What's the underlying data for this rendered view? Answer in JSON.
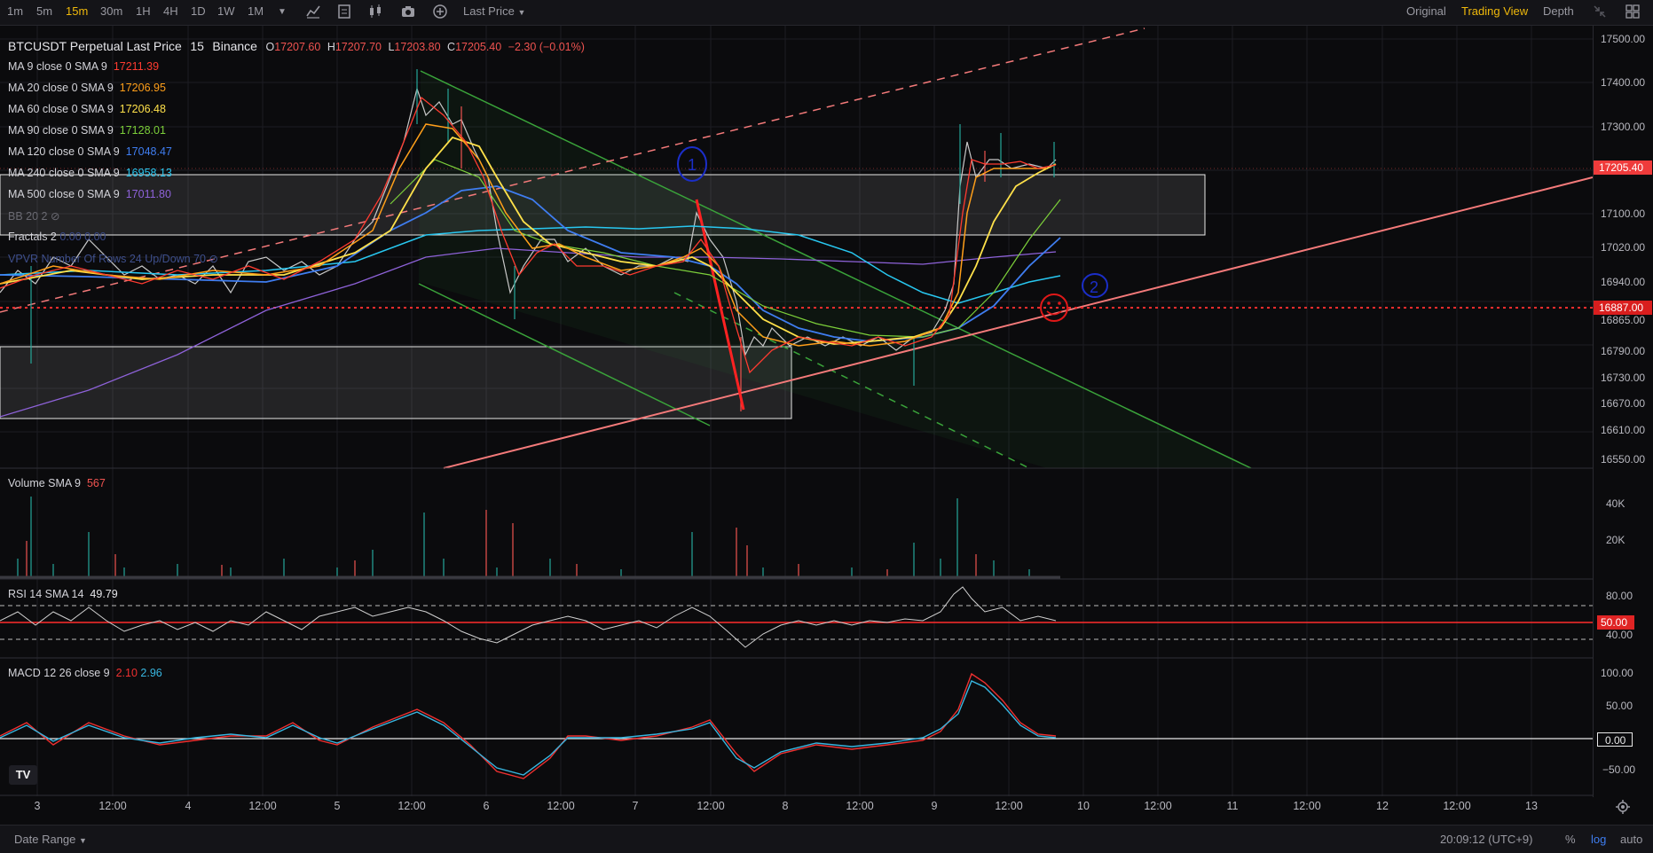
{
  "toolbar": {
    "intervals": [
      "1m",
      "5m",
      "15m",
      "30m",
      "1H",
      "4H",
      "1D",
      "1W",
      "1M"
    ],
    "active_interval": "15m",
    "price_type": "Last Price",
    "views": [
      "Original",
      "Trading View",
      "Depth"
    ],
    "active_view": "Trading View"
  },
  "header": {
    "symbol": "BTCUSDT Perpetual Last Price",
    "interval": "15",
    "exchange": "Binance",
    "open_label": "O",
    "open": "17207.60",
    "high_label": "H",
    "high": "17207.70",
    "low_label": "L",
    "low": "17203.80",
    "close_label": "C",
    "close": "17205.40",
    "change": "−2.30 (−0.01%)"
  },
  "moving_averages": [
    {
      "label": "MA 9 close 0 SMA 9",
      "value": "17211.39",
      "color": "#ff3b30"
    },
    {
      "label": "MA 20 close 0 SMA 9",
      "value": "17206.95",
      "color": "#ff9f1a"
    },
    {
      "label": "MA 60 close 0 SMA 9",
      "value": "17206.48",
      "color": "#ffe14a"
    },
    {
      "label": "MA 90 close 0 SMA 9",
      "value": "17128.01",
      "color": "#7ccf3a"
    },
    {
      "label": "MA 120 close 0 SMA 9",
      "value": "17048.47",
      "color": "#3f7df0"
    },
    {
      "label": "MA 240 close 0 SMA 9",
      "value": "16958.13",
      "color": "#28c7f0"
    },
    {
      "label": "MA 500 close 0 SMA 9",
      "value": "17011.80",
      "color": "#8e62d9"
    }
  ],
  "other_indicators": {
    "bb": "BB 20 2",
    "fractals": "Fractals 2",
    "fractals_values": "0.00  0.00",
    "vpvr": "VPVR Number Of Rows 24 Up/Down 70"
  },
  "price_axis": {
    "ticks": [
      "17500.00",
      "17400.00",
      "17300.00",
      "17205.40",
      "17100.00",
      "17020.00",
      "16940.00",
      "16887.00",
      "16865.00",
      "16790.00",
      "16730.00",
      "16670.00",
      "16610.00",
      "16550.00"
    ],
    "current_price": "17205.40",
    "marked_price": "16887.00"
  },
  "volume": {
    "label": "Volume SMA 9",
    "value": "567",
    "ticks": [
      "40K",
      "20K"
    ]
  },
  "rsi": {
    "label": "RSI 14 SMA 14",
    "value": "49.79",
    "ticks": [
      "80.00",
      "40.00"
    ],
    "mid_value": "50.00"
  },
  "macd": {
    "label": "MACD 12 26 close 9",
    "value1": "2.10",
    "value2": "2.96",
    "ticks": [
      "100.00",
      "50.00",
      "−50.00"
    ],
    "zero_value": "0.00"
  },
  "time_axis": [
    "3",
    "12:00",
    "4",
    "12:00",
    "5",
    "12:00",
    "6",
    "12:00",
    "7",
    "12:00",
    "8",
    "12:00",
    "9",
    "12:00",
    "10",
    "12:00",
    "11",
    "12:00",
    "12",
    "12:00",
    "13"
  ],
  "annotations": {
    "circle_one": "1",
    "circle_two": "2"
  },
  "bottom": {
    "date_range": "Date Range",
    "clock": "20:09:12 (UTC+9)",
    "percent": "%",
    "log": "log",
    "auto": "auto"
  },
  "logo": "TV",
  "colors": {
    "accent": "#f0b90b",
    "up": "#26a69a",
    "down": "#ef5350",
    "red_line": "#ff2d2d",
    "trend_pink": "#f47a7a"
  }
}
